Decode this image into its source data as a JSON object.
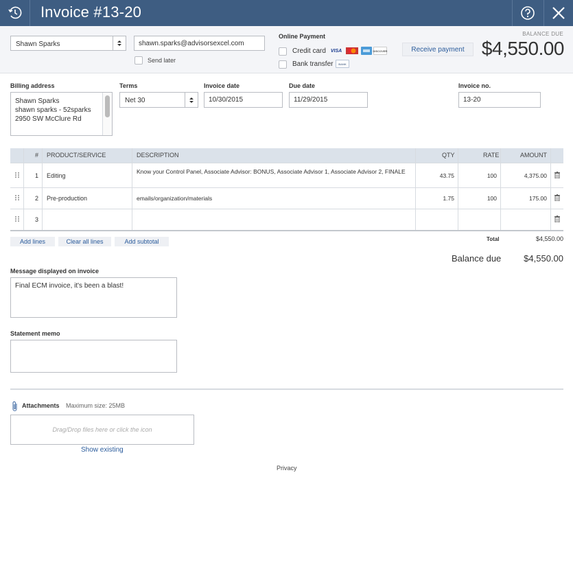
{
  "window": {
    "title": "Invoice #13-20"
  },
  "header": {
    "customer": "Shawn Sparks",
    "email": "shawn.sparks@advisorsexcel.com",
    "send_later_label": "Send later",
    "online_payment_label": "Online Payment",
    "credit_card_label": "Credit card",
    "bank_transfer_label": "Bank transfer",
    "card_icons": [
      "VISA",
      "MC",
      "AMEX",
      "DISCOVER"
    ],
    "bank_icon": "BANK",
    "receive_payment_label": "Receive payment",
    "balance_due_label": "BALANCE DUE",
    "balance_due_amount": "$4,550.00"
  },
  "billing": {
    "billing_address_label": "Billing address",
    "address_lines": [
      "Shawn Sparks",
      "shawn sparks - 52sparks",
      "2950 SW McClure Rd"
    ],
    "terms_label": "Terms",
    "terms_value": "Net 30",
    "invoice_date_label": "Invoice date",
    "invoice_date": "10/30/2015",
    "due_date_label": "Due date",
    "due_date": "11/29/2015",
    "invoice_no_label": "Invoice no.",
    "invoice_no": "13-20"
  },
  "table": {
    "columns": [
      "#",
      "PRODUCT/SERVICE",
      "DESCRIPTION",
      "QTY",
      "RATE",
      "AMOUNT"
    ],
    "rows": [
      {
        "num": "1",
        "product": "Editing",
        "description": "Know your Control Panel, Associate Advisor: BONUS, Associate Advisor 1, Associate Advisor 2, FINALE",
        "qty": "43.75",
        "rate": "100",
        "amount": "4,375.00"
      },
      {
        "num": "2",
        "product": "Pre-production",
        "description": "emails/organization/materials",
        "qty": "1.75",
        "rate": "100",
        "amount": "175.00"
      },
      {
        "num": "3",
        "product": "",
        "description": "",
        "qty": "",
        "rate": "",
        "amount": ""
      }
    ],
    "add_lines_label": "Add lines",
    "clear_all_label": "Clear all lines",
    "add_subtotal_label": "Add subtotal",
    "total_label": "Total",
    "total_value": "$4,550.00",
    "balance_due_label": "Balance due",
    "balance_due_value": "$4,550.00"
  },
  "message": {
    "label": "Message displayed on invoice",
    "value": "Final ECM invoice, it's been a blast!"
  },
  "memo": {
    "label": "Statement memo",
    "value": ""
  },
  "attachments": {
    "label": "Attachments",
    "max_size": "Maximum size: 25MB",
    "drop_hint": "Drag/Drop files here or click the icon",
    "show_existing": "Show existing"
  },
  "footer": {
    "privacy": "Privacy"
  },
  "colors": {
    "titlebar": "#3e5d82",
    "link": "#2b5c9c",
    "table_header": "#dbe2ea",
    "header_band": "#f4f5f8"
  }
}
